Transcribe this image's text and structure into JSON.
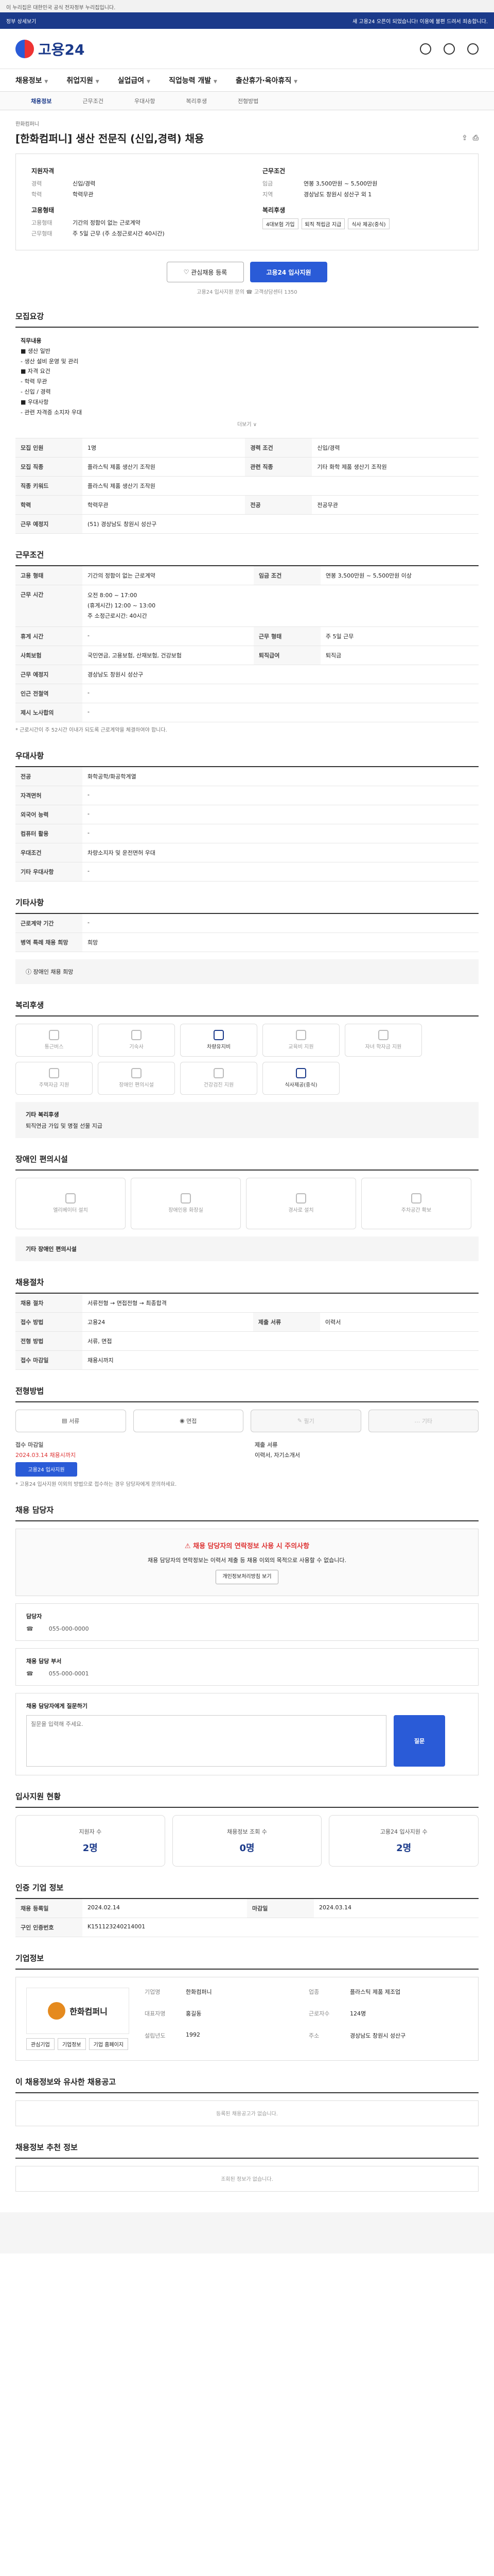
{
  "topbar": {
    "text": "이 누리집은 대한민국 공식 전자정부 누리집입니다."
  },
  "notice": {
    "text": "정부 상세보기",
    "right": "새 고용24 오픈이 되었습니다! 이용에 불편 드려서 죄송합니다."
  },
  "header": {
    "logo": "고용24"
  },
  "gnb": [
    "채용정보",
    "취업지원",
    "실업급여",
    "직업능력 개발",
    "출산휴가·육아휴직"
  ],
  "tabs": [
    "채용정보",
    "근무조건",
    "우대사항",
    "복리후생",
    "전형방법"
  ],
  "job": {
    "company": "한화컴퍼니",
    "title": "[한화컴퍼니] 생산 전문직 (신입,경력) 채용",
    "summary": {
      "left_head": "지원자격",
      "right_head": "근무조건",
      "left_rows": [
        {
          "k": "경력",
          "v": "신입/경력"
        },
        {
          "k": "학력",
          "v": "학력무관"
        }
      ],
      "right_rows": [
        {
          "k": "임금",
          "v": "연봉 3,500만원 ~ 5,500만원"
        },
        {
          "k": "지역",
          "v": "경상남도 창원시 성산구 외 1"
        }
      ],
      "left_head2": "고용형태",
      "right_head2": "복리후생",
      "left_rows2": [
        {
          "k": "고용형태",
          "v": "기간의 정함이 없는 근로계약"
        },
        {
          "k": "근무형태",
          "v": "주 5일 근무 (주 소정근로시간 40시간)"
        }
      ],
      "benefits": [
        "4대보험 가입",
        "퇴직 적립금 지급",
        "식사 제공(중식)"
      ]
    },
    "btn_interest": "관심채용 등록",
    "btn_apply": "고용24 입사지원",
    "btn_note": "고용24 입사지원 문의 ☎ 고객상담센터 1350"
  },
  "recruit": {
    "heading": "모집요강",
    "duty_title": "직무내용",
    "duty_lines": [
      "■ 생산 일반",
      "- 생산 설비 운영 및 관리",
      "■ 자격 요건",
      "- 학력 무관",
      "- 신입 / 경력",
      "■ 우대사항",
      "- 관련 자격증 소지자 우대"
    ],
    "more": "더보기 ∨",
    "rows": [
      {
        "k": "모집 인원",
        "v": "1명",
        "k2": "경력 조건",
        "v2": "신입/경력"
      },
      {
        "k": "모집 직종",
        "v": "플라스틱 제품 생산기 조작원",
        "k2": "관련 직종",
        "v2": "기타 화학 제품 생산기 조작원"
      },
      {
        "k": "직종 키워드",
        "v": "플라스틱 제품 생산기 조작원",
        "k2": "",
        "v2": ""
      },
      {
        "k": "학력",
        "v": "학력무관",
        "k2": "전공",
        "v2": "전공무관"
      },
      {
        "k": "근무 예정지",
        "v": "(51) 경상남도 창원시 성산구",
        "k2": "",
        "v2": ""
      }
    ]
  },
  "conditions": {
    "heading": "근무조건",
    "wage_k": "고용 형태",
    "wage_v": "기간의 정함이 없는 근로계약",
    "pay_k": "임금 조건",
    "pay_v": "연봉 3,500만원 ~ 5,500만원 이상",
    "time_k": "근무 시간",
    "time_lines": [
      "오전 8:00 ~ 17:00",
      "(휴게시간) 12:00 ~ 13:00",
      "주 소정근로시간: 40시간"
    ],
    "rows": [
      {
        "k": "휴게 시간",
        "v": "-",
        "k2": "근무 형태",
        "v2": "주 5일 근무"
      },
      {
        "k": "사회보험",
        "v": "국민연금, 고용보험, 산재보험, 건강보험",
        "k2": "퇴직급여",
        "v2": "퇴직금"
      },
      {
        "k": "근무 예정지",
        "v": "경상남도 창원시 성산구",
        "k2": "",
        "v2": ""
      },
      {
        "k": "인근 전철역",
        "v": "-",
        "k2": "",
        "v2": ""
      },
      {
        "k": "제시 노사합의",
        "v": "-",
        "k2": "",
        "v2": ""
      }
    ],
    "note": "* 근로시간이 주 52시간 이내가 되도록 근로계약을 체결하여야 합니다."
  },
  "preference": {
    "heading": "우대사항",
    "rows": [
      {
        "k": "전공",
        "v": "화학공학/화공학계열"
      },
      {
        "k": "자격면허",
        "v": "-"
      },
      {
        "k": "외국어 능력",
        "v": "-"
      },
      {
        "k": "컴퓨터 활용",
        "v": "-"
      },
      {
        "k": "우대조건",
        "v": "차량소지자 및 운전면허 우대"
      },
      {
        "k": "기타 우대사항",
        "v": "-"
      }
    ]
  },
  "other": {
    "heading": "기타사항",
    "rows": [
      {
        "k": "근로계약 기간",
        "v": "-"
      },
      {
        "k": "병역 특례 채용 희망",
        "v": "희망"
      }
    ],
    "extra": "장애인 채용 희망"
  },
  "welfare": {
    "heading": "복리후생",
    "items": [
      {
        "name": "통근버스",
        "on": false
      },
      {
        "name": "기숙사",
        "on": false
      },
      {
        "name": "차량유지비",
        "on": true
      },
      {
        "name": "교육비 지원",
        "on": false
      },
      {
        "name": "자녀 학자금 지원",
        "on": false
      },
      {
        "name": "주택자금 지원",
        "on": false
      },
      {
        "name": "장애인 편의시설",
        "on": false
      },
      {
        "name": "건강검진 지원",
        "on": false
      },
      {
        "name": "식사제공(중식)",
        "on": true
      }
    ],
    "other_title": "기타 복리후생",
    "other_text": "퇴직연금 가입 및 명절 선물 지급"
  },
  "disabled": {
    "heading": "장애인 편의시설",
    "items": [
      "엘리베이터 설치",
      "장애인용 화장실",
      "경사로 설치",
      "주차공간 확보"
    ],
    "other_title": "기타 장애인 편의시설"
  },
  "process": {
    "heading": "채용절차",
    "rows": [
      {
        "k": "채용 절차",
        "v": "서류전형 → 면접전형 → 최종합격",
        "k2": "",
        "v2": ""
      },
      {
        "k": "접수 방법",
        "v": "고용24",
        "k2": "제출 서류",
        "v2": "이력서"
      },
      {
        "k": "전형 방법",
        "v": "서류, 면접",
        "k2": "",
        "v2": ""
      },
      {
        "k": "접수 마감일",
        "v": "채용시까지",
        "k2": "",
        "v2": ""
      }
    ]
  },
  "apply": {
    "heading": "전형방법",
    "methods": [
      {
        "label": "서류",
        "off": false
      },
      {
        "label": "면접",
        "off": false
      },
      {
        "label": "필기",
        "off": true
      },
      {
        "label": "기타",
        "off": true
      }
    ],
    "deadline_label": "접수 마감일",
    "deadline": "2024.03.14 채용시까지",
    "apply_btn": "고용24 입사지원",
    "docs_label": "제출 서류",
    "docs": "이력서, 자기소개서",
    "note": "* 고용24 입사지원 이외의 방법으로 접수하는 경우 담당자에게 문의하세요."
  },
  "manager": {
    "heading": "채용 담당자",
    "warn_title": "채용 담당자의 연락정보 사용 시 주의사항",
    "warn_text": "채용 담당자의 연락정보는 이력서 제출 등 채용 이외의 목적으로 사용할 수 없습니다.",
    "warn_btn": "개인정보처리방침 보기",
    "mgr_title": "담당자",
    "mgr_phone": "055-000-0000",
    "mgr2_title": "채용 담당 부서",
    "mgr2_phone": "055-000-0001"
  },
  "question": {
    "heading": "채용 담당자에게 질문하기",
    "placeholder": "질문을 입력해 주세요.",
    "submit": "질문"
  },
  "stats": {
    "heading": "입사지원 현황",
    "items": [
      {
        "label": "지원자 수",
        "value": "2명"
      },
      {
        "label": "채용정보 조회 수",
        "value": "0명"
      },
      {
        "label": "고용24 입사지원 수",
        "value": "2명"
      }
    ]
  },
  "info": {
    "heading": "인증 기업 정보",
    "rows": [
      {
        "k": "채용 등록일",
        "v": "2024.02.14",
        "k2": "마감일",
        "v2": "2024.03.14"
      },
      {
        "k": "구인 인증번호",
        "v": "K151123240214001",
        "k2": "",
        "v2": ""
      }
    ]
  },
  "companyinfo": {
    "heading": "기업정보",
    "logo_text": "한화컴퍼니",
    "btns": [
      "관심기업",
      "기업정보",
      "기업 홈페이지"
    ],
    "rows": [
      {
        "k": "기업명",
        "v": "한화컴퍼니",
        "k2": "업종",
        "v2": "플라스틱 제품 제조업"
      },
      {
        "k": "대표자명",
        "v": "홍길동",
        "k2": "근로자수",
        "v2": "124명"
      },
      {
        "k": "설립년도",
        "v": "1992",
        "k2": "주소",
        "v2": "경상남도 창원시 성산구"
      }
    ]
  },
  "similar": {
    "heading": "이 채용정보와 유사한 채용공고",
    "empty": "등록된 채용공고가 없습니다."
  },
  "recommend": {
    "heading": "채용정보 추천 정보",
    "empty": "조회된 정보가 없습니다."
  }
}
